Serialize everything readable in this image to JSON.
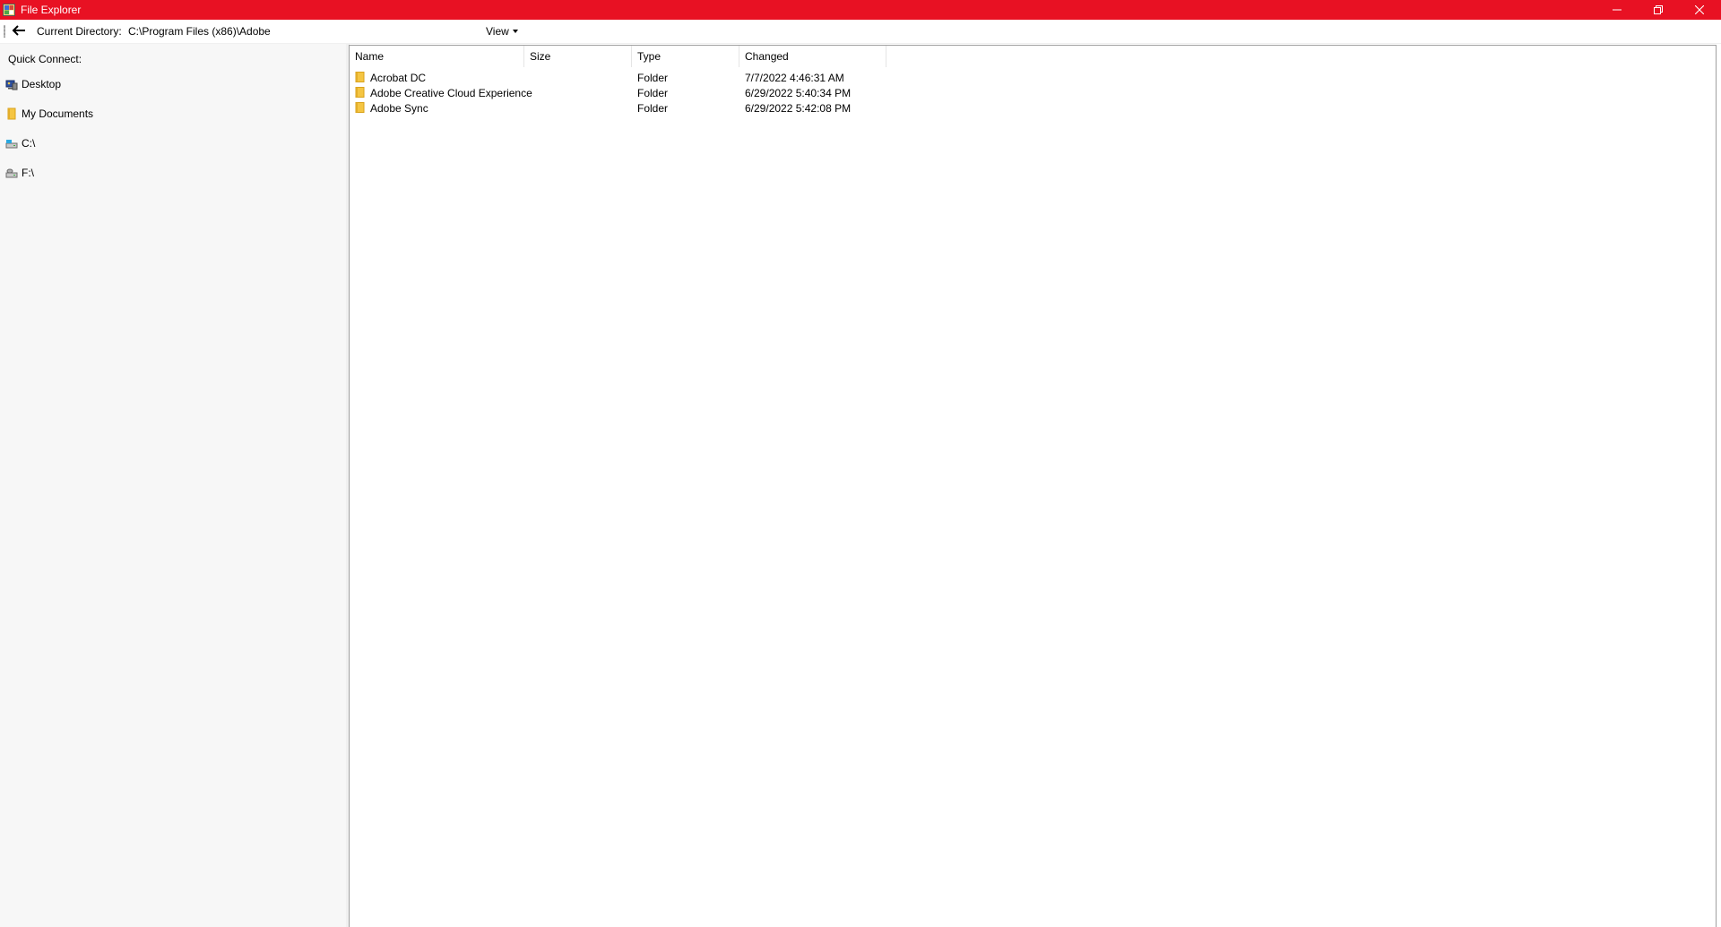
{
  "window": {
    "title": "File Explorer",
    "accent_color": "#e81123",
    "controls": [
      "minimize-icon",
      "restore-icon",
      "close-icon"
    ]
  },
  "toolbar": {
    "back_icon": "back-arrow-icon",
    "directory_label": "Current Directory:",
    "directory_value": "C:\\Program Files (x86)\\Adobe",
    "view_label": "View"
  },
  "sidebar": {
    "heading": "Quick Connect:",
    "items": [
      {
        "label": "Desktop",
        "icon": "desktop-icon"
      },
      {
        "label": "My Documents",
        "icon": "folder-icon"
      },
      {
        "label": "C:\\",
        "icon": "drive-icon"
      },
      {
        "label": "F:\\",
        "icon": "drive-icon"
      }
    ]
  },
  "files": {
    "columns": [
      "Name",
      "Size",
      "Type",
      "Changed"
    ],
    "rows": [
      {
        "name": "Acrobat DC",
        "size": "",
        "type": "Folder",
        "changed": "7/7/2022 4:46:31 AM"
      },
      {
        "name": "Adobe Creative Cloud Experience",
        "size": "",
        "type": "Folder",
        "changed": "6/29/2022 5:40:34 PM"
      },
      {
        "name": "Adobe Sync",
        "size": "",
        "type": "Folder",
        "changed": "6/29/2022 5:42:08 PM"
      }
    ]
  }
}
